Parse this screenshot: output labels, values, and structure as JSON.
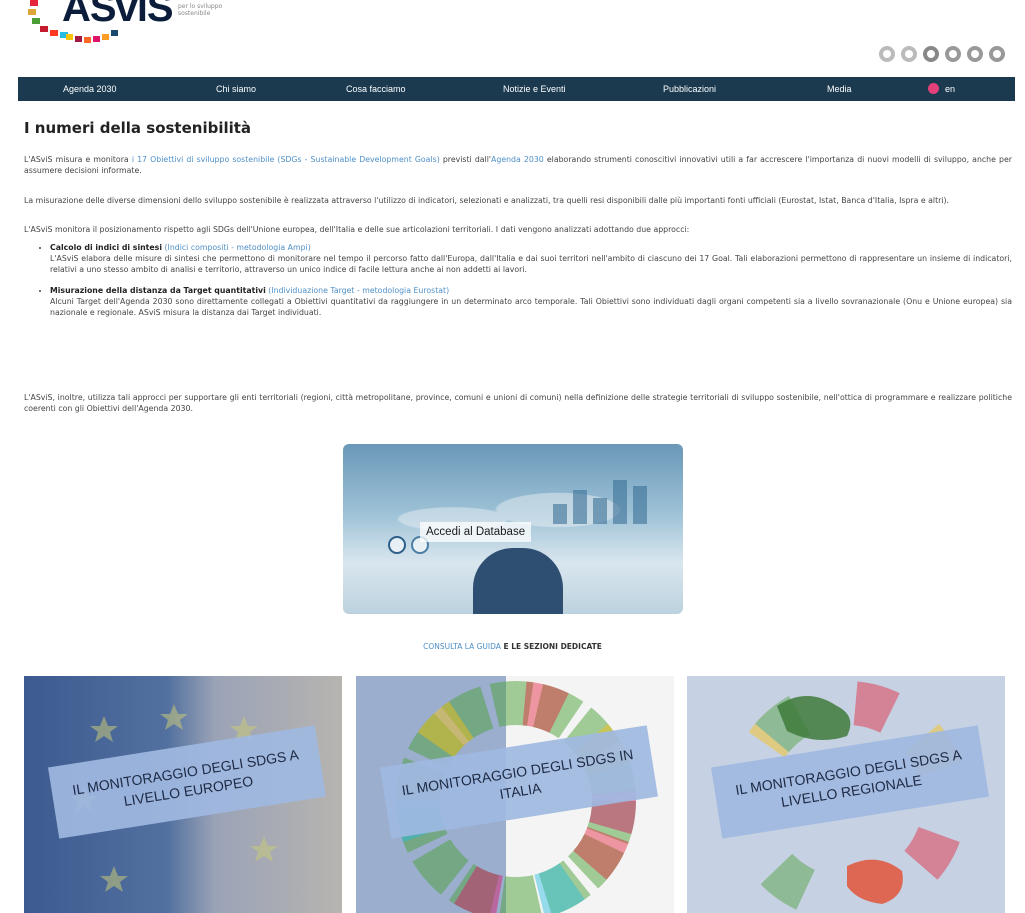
{
  "header": {
    "logo_text": "ASviS",
    "logo_sub": "per lo sviluppo sostenibile"
  },
  "nav": {
    "items": [
      "Agenda 2030",
      "Chi siamo",
      "Cosa facciamo",
      "Notizie e Eventi",
      "Pubblicazioni",
      "Media"
    ],
    "lang": "en"
  },
  "page": {
    "title": "I numeri della sostenibilità",
    "p1_a": "L'ASviS misura e monitora ",
    "p1_link1": "i 17 Obiettivi di sviluppo sostenibile (SDGs - Sustainable Development Goals)",
    "p1_b": " previsti dall'",
    "p1_link2": "Agenda 2030",
    "p1_c": " elaborando strumenti conoscitivi innovativi utili a far accrescere l'importanza di nuovi modelli di sviluppo, anche per assumere decisioni informate.",
    "p2": "La misurazione delle diverse dimensioni dello sviluppo sostenibile è realizzata attraverso l'utilizzo di indicatori, selezionati e analizzati, tra quelli resi disponibili dalle più importanti fonti ufficiali (Eurostat, Istat, Banca d'Italia, Ispra e altri).",
    "p3": "L'ASviS monitora il posizionamento rispetto agli SDGs dell'Unione europea, dell'Italia e delle sue articolazioni territoriali. I dati vengono analizzati adottando due approcci:",
    "b1_title": "Calcolo di indici di sintesi",
    "b1_link": "(Indici compositi - metodologia Ampi)",
    "b1_text": "L'ASviS elabora delle misure di sintesi che permettono di monitorare nel tempo il percorso fatto dall'Europa, dall'Italia e dai suoi territori nell'ambito di ciascuno dei 17 Goal. Tali elaborazioni permettono di rappresentare un insieme di indicatori, relativi a uno stesso ambito di analisi e territorio, attraverso un unico indice di facile lettura anche ai non addetti ai lavori.",
    "b2_title": "Misurazione della distanza da Target quantitativi",
    "b2_link": "(Individuazione Target - metodologia Eurostat)",
    "b2_text": "Alcuni Target dell'Agenda 2030 sono direttamente collegati a Obiettivi quantitativi da raggiungere in un determinato arco temporale. Tali Obiettivi sono individuati dagli organi competenti sia a livello sovranazionale (Onu e Unione europea) sia nazionale e regionale. ASviS misura la distanza dai Target individuati.",
    "p4": "L'ASviS, inoltre, utilizza tali approcci per supportare gli enti territoriali (regioni, città metropolitane, province, comuni e unioni di comuni) nella definizione delle strategie territoriali di sviluppo sostenibile, nell'ottica di programmare e realizzare politiche coerenti con gli Obiettivi dell'Agenda 2030."
  },
  "database": {
    "label": "Accedi al Database"
  },
  "guide": {
    "link": "CONSULTA LA GUIDA",
    "rest": " E LE SEZIONI DEDICATE"
  },
  "cards": [
    {
      "label": "IL MONITORAGGIO DEGLI SDGS A LIVELLO EUROPEO"
    },
    {
      "label": "IL MONITORAGGIO DEGLI SDGS IN ITALIA"
    },
    {
      "label": "IL MONITORAGGIO DEGLI SDGS A LIVELLO REGIONALE"
    }
  ],
  "colors": {
    "nav_bg": "#1b3a4f",
    "link": "#4f8fc7",
    "card_banner": "#a0b9e1"
  }
}
